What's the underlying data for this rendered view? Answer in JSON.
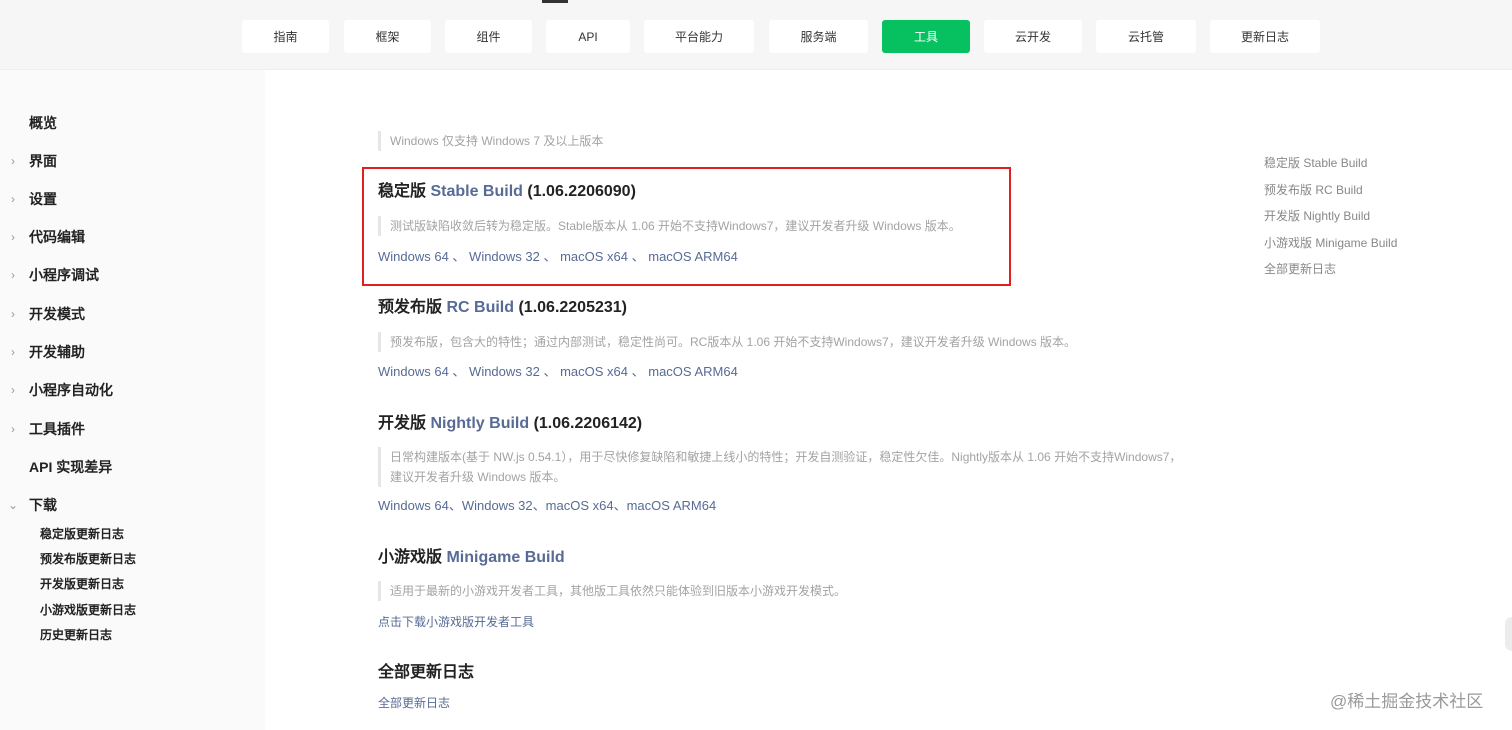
{
  "top_nav": {
    "tabs": [
      {
        "label": "指南",
        "active": false
      },
      {
        "label": "框架",
        "active": false
      },
      {
        "label": "组件",
        "active": false
      },
      {
        "label": "API",
        "active": false
      },
      {
        "label": "平台能力",
        "active": false
      },
      {
        "label": "服务端",
        "active": false
      },
      {
        "label": "工具",
        "active": true
      },
      {
        "label": "云开发",
        "active": false
      },
      {
        "label": "云托管",
        "active": false
      },
      {
        "label": "更新日志",
        "active": false
      }
    ],
    "active_color": "#07c160"
  },
  "sidebar": {
    "items": [
      {
        "label": "概览",
        "chevron": ""
      },
      {
        "label": "界面",
        "chevron": "›"
      },
      {
        "label": "设置",
        "chevron": "›"
      },
      {
        "label": "代码编辑",
        "chevron": "›"
      },
      {
        "label": "小程序调试",
        "chevron": "›"
      },
      {
        "label": "开发模式",
        "chevron": "›"
      },
      {
        "label": "开发辅助",
        "chevron": "›"
      },
      {
        "label": "小程序自动化",
        "chevron": "›"
      },
      {
        "label": "工具插件",
        "chevron": "›"
      },
      {
        "label": "API 实现差异",
        "chevron": ""
      },
      {
        "label": "下载",
        "chevron": "⌄"
      }
    ],
    "sub_items": [
      "稳定版更新日志",
      "预发布版更新日志",
      "开发版更新日志",
      "小游戏版更新日志",
      "历史更新日志"
    ]
  },
  "main": {
    "top_note": "Windows 仅支持 Windows 7 及以上版本",
    "stable": {
      "title_cn": "稳定版",
      "title_en": "Stable Build",
      "version": "(1.06.2206090)",
      "note": "测试版缺陷收敛后转为稳定版。Stable版本从 1.06 开始不支持Windows7，建议开发者升级 Windows 版本。",
      "links": [
        "Windows 64",
        "Windows 32",
        "macOS x64",
        "macOS ARM64"
      ],
      "sep": " 、 "
    },
    "rc": {
      "title_cn": "预发布版",
      "title_en": "RC Build",
      "version": "(1.06.2205231)",
      "note": "预发布版，包含大的特性；通过内部测试，稳定性尚可。RC版本从 1.06 开始不支持Windows7，建议开发者升级 Windows 版本。",
      "links": [
        "Windows 64",
        "Windows 32",
        "macOS x64",
        "macOS ARM64"
      ],
      "sep": " 、 "
    },
    "nightly": {
      "title_cn": "开发版",
      "title_en": "Nightly Build",
      "version": "(1.06.2206142)",
      "note_line1": "日常构建版本(基于 NW.js 0.54.1），用于尽快修复缺陷和敏捷上线小的特性；开发自测验证，稳定性欠佳。Nightly版本从 1.06 开始不支持Windows7，",
      "note_line2": "建议开发者升级 Windows 版本。",
      "links": [
        "Windows 64",
        "Windows 32",
        "macOS x64",
        "macOS ARM64"
      ],
      "sep": "、"
    },
    "minigame": {
      "title_cn": "小游戏版",
      "title_en": "Minigame Build",
      "note": "适用于最新的小游戏开发者工具，其他版工具依然只能体验到旧版本小游戏开发模式。",
      "link": "点击下载小游戏版开发者工具"
    },
    "all": {
      "title": "全部更新日志",
      "link": "全部更新日志"
    },
    "highlight_color": "#e0201f"
  },
  "toc": [
    "稳定版 Stable Build",
    "预发布版 RC Build",
    "开发版 Nightly Build",
    "小游戏版 Minigame Build",
    "全部更新日志"
  ],
  "watermark": "@稀土掘金技术社区",
  "colors": {
    "link": "#576b95",
    "note": "#a3a3a3"
  }
}
